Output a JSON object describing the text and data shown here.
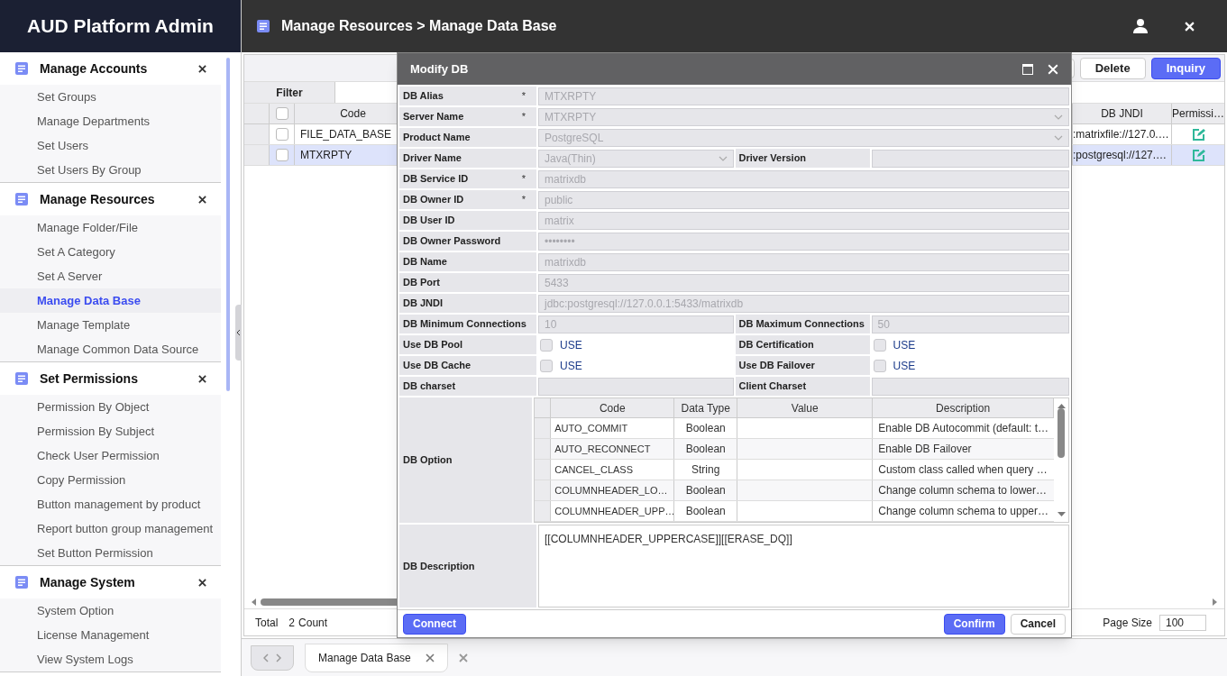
{
  "app_title": "AUD Platform Admin",
  "breadcrumb": "Manage Resources > Manage Data Base",
  "sidebar": {
    "sections": [
      {
        "title": "Manage Accounts",
        "items": [
          {
            "label": "Set Groups",
            "selected": false
          },
          {
            "label": "Manage Departments",
            "selected": false
          },
          {
            "label": "Set Users",
            "selected": false
          },
          {
            "label": "Set Users By Group",
            "selected": false
          }
        ]
      },
      {
        "title": "Manage Resources",
        "items": [
          {
            "label": "Manage Folder/File",
            "selected": false
          },
          {
            "label": "Set A Category",
            "selected": false
          },
          {
            "label": "Set A Server",
            "selected": false
          },
          {
            "label": "Manage Data Base",
            "selected": true
          },
          {
            "label": "Manage Template",
            "selected": false
          },
          {
            "label": "Manage Common Data Source",
            "selected": false
          }
        ]
      },
      {
        "title": "Set Permissions",
        "items": [
          {
            "label": "Permission By Object",
            "selected": false
          },
          {
            "label": "Permission By Subject",
            "selected": false
          },
          {
            "label": "Check User Permission",
            "selected": false
          },
          {
            "label": "Copy Permission",
            "selected": false
          },
          {
            "label": "Button management by product",
            "selected": false
          },
          {
            "label": "Report button group management",
            "selected": false
          },
          {
            "label": "Set Button Permission",
            "selected": false
          }
        ]
      },
      {
        "title": "Manage System",
        "items": [
          {
            "label": "System Option",
            "selected": false
          },
          {
            "label": "License Management",
            "selected": false
          },
          {
            "label": "View System Logs",
            "selected": false
          }
        ]
      }
    ]
  },
  "toolbar": {
    "buttons": [
      {
        "label": "Delete",
        "kind": "default"
      },
      {
        "label": "Inquiry",
        "kind": "primary"
      }
    ]
  },
  "filter": {
    "label": "Filter"
  },
  "grid": {
    "header_checked": false,
    "columns": [
      "Code",
      "DB JNDI",
      "Permissi…"
    ],
    "rows": [
      {
        "code": "FILE_DATA_BASE",
        "jndi": ":matrixfile://127.0.…",
        "checked": false,
        "selected": false
      },
      {
        "code": "MTXRPTY",
        "jndi": ":postgresql://127.…",
        "checked": false,
        "selected": true
      }
    ]
  },
  "footer": {
    "total_label": "Total",
    "count": "2",
    "count_label": "Count",
    "page_size_label": "Page Size",
    "page_size": "100"
  },
  "tabs": [
    {
      "label": "Manage Data Base",
      "selected": true
    }
  ],
  "dialog": {
    "title": "Modify DB",
    "rows": [
      {
        "cells": [
          {
            "label": "DB Alias",
            "required_mark": "*",
            "kind": "input",
            "value": "MTXRPTY"
          }
        ]
      },
      {
        "cells": [
          {
            "label": "Server Name",
            "required_mark": "*",
            "kind": "select",
            "value": "MTXRPTY"
          }
        ]
      },
      {
        "cells": [
          {
            "label": "Product Name",
            "kind": "select",
            "value": "PostgreSQL"
          }
        ]
      },
      {
        "cells": [
          {
            "label": "Driver Name",
            "kind": "select",
            "value": "Java(Thin)"
          },
          {
            "label": "Driver Version",
            "kind": "input"
          }
        ]
      },
      {
        "cells": [
          {
            "label": "DB Service ID",
            "required_mark": "*",
            "kind": "input",
            "value": "matrixdb"
          }
        ]
      },
      {
        "cells": [
          {
            "label": "DB Owner ID",
            "required_mark": "*",
            "kind": "input",
            "value": "public"
          }
        ]
      },
      {
        "cells": [
          {
            "label": "DB User ID",
            "kind": "input",
            "value": "matrix"
          }
        ]
      },
      {
        "cells": [
          {
            "label": "DB Owner Password",
            "kind": "input",
            "value": "••••••••"
          }
        ]
      },
      {
        "cells": [
          {
            "label": "DB Name",
            "kind": "input",
            "value": "matrixdb"
          }
        ]
      },
      {
        "cells": [
          {
            "label": "DB Port",
            "kind": "input",
            "value": "5433"
          }
        ]
      },
      {
        "cells": [
          {
            "label": "DB JNDI",
            "kind": "input",
            "value": "jdbc:postgresql://127.0.0.1:5433/matrixdb"
          }
        ]
      },
      {
        "cells": [
          {
            "label": "DB Minimum Connections",
            "kind": "input",
            "value": "10"
          },
          {
            "label": "DB Maximum Connections",
            "kind": "input",
            "value": "50"
          }
        ]
      },
      {
        "cells": [
          {
            "label": "Use DB Pool",
            "kind": "checkbox",
            "checked": false,
            "check_label": "USE"
          },
          {
            "label": "DB Certification",
            "kind": "checkbox",
            "checked": false,
            "check_label": "USE"
          }
        ]
      },
      {
        "cells": [
          {
            "label": "Use DB Cache",
            "kind": "checkbox",
            "checked": false,
            "check_label": "USE"
          },
          {
            "label": "Use DB Failover",
            "kind": "checkbox",
            "checked": false,
            "check_label": "USE"
          }
        ]
      },
      {
        "cells": [
          {
            "label": "DB charset",
            "kind": "input"
          },
          {
            "label": "Client Charset",
            "kind": "input"
          }
        ]
      }
    ],
    "option_label": "DB Option",
    "option_columns": [
      "Code",
      "Data Type",
      "Value",
      "Description"
    ],
    "options": [
      {
        "code": "AUTO_COMMIT",
        "data_type": "Boolean",
        "description": "Enable DB Autocommit (default: t…"
      },
      {
        "code": "AUTO_RECONNECT",
        "data_type": "Boolean",
        "description": "Enable DB Failover"
      },
      {
        "code": "CANCEL_CLASS",
        "data_type": "String",
        "description": "Custom class called when query …"
      },
      {
        "code": "COLUMNHEADER_LO…",
        "data_type": "Boolean",
        "description": "Change column schema to lower…"
      },
      {
        "code": "COLUMNHEADER_UPP…",
        "data_type": "Boolean",
        "description": "Change column schema to upper…"
      }
    ],
    "description_label": "DB Description",
    "description": "[[COLUMNHEADER_UPPERCASE]][[ERASE_DQ]]",
    "buttons": [
      {
        "label": "Connect",
        "kind": "primary"
      },
      {
        "label": "Confirm",
        "kind": "primary"
      },
      {
        "label": "Cancel",
        "kind": "default"
      }
    ]
  }
}
